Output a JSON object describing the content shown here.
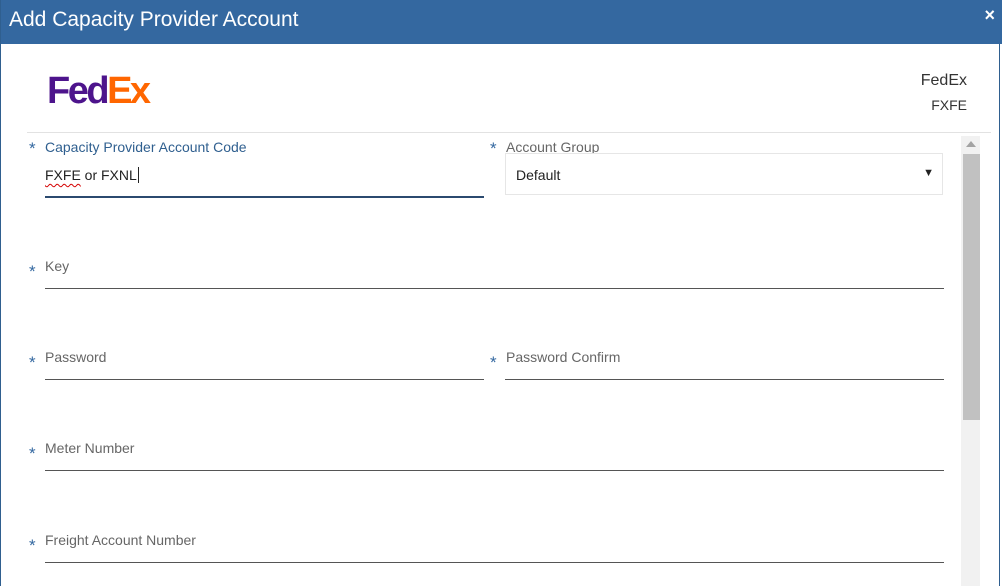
{
  "dialog": {
    "title": "Add Capacity Provider Account",
    "close_label": "×"
  },
  "carrier": {
    "logo_fed": "Fed",
    "logo_ex": "Ex",
    "name": "FedEx",
    "code": "FXFE"
  },
  "form": {
    "required_marker": "*",
    "account_code": {
      "label": "Capacity Provider Account Code",
      "value_misspelled": "FXFE",
      "value_rest": " or FXNL"
    },
    "account_group": {
      "label": "Account Group",
      "selected": "Default",
      "arrow": "▼"
    },
    "key": {
      "label": "Key"
    },
    "password": {
      "label": "Password"
    },
    "password_confirm": {
      "label": "Password Confirm"
    },
    "meter_number": {
      "label": "Meter Number"
    },
    "freight_account_number": {
      "label": "Freight Account Number"
    }
  }
}
